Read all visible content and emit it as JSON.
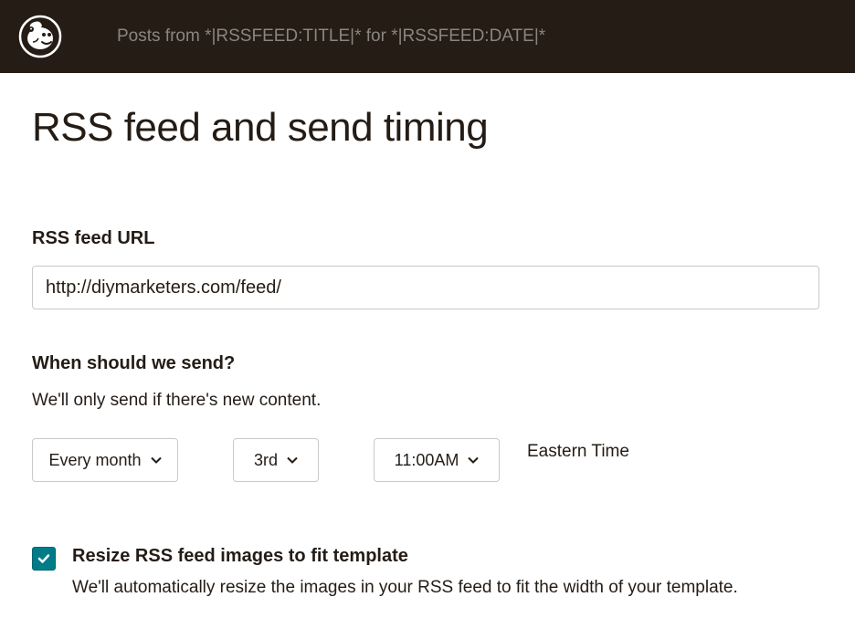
{
  "header": {
    "title": "Posts from *|RSSFEED:TITLE|* for *|RSSFEED:DATE|*"
  },
  "page": {
    "title": "RSS feed and send timing"
  },
  "rss_url": {
    "label": "RSS feed URL",
    "value": "http://diymarketers.com/feed/"
  },
  "schedule": {
    "label": "When should we send?",
    "helper": "We'll only send if there's new content.",
    "frequency": "Every month",
    "day": "3rd",
    "time": "11:00AM",
    "timezone": "Eastern Time"
  },
  "resize": {
    "checked": true,
    "label": "Resize RSS feed images to fit template",
    "helper": "We'll automatically resize the images in your RSS feed to fit the width of your template."
  }
}
